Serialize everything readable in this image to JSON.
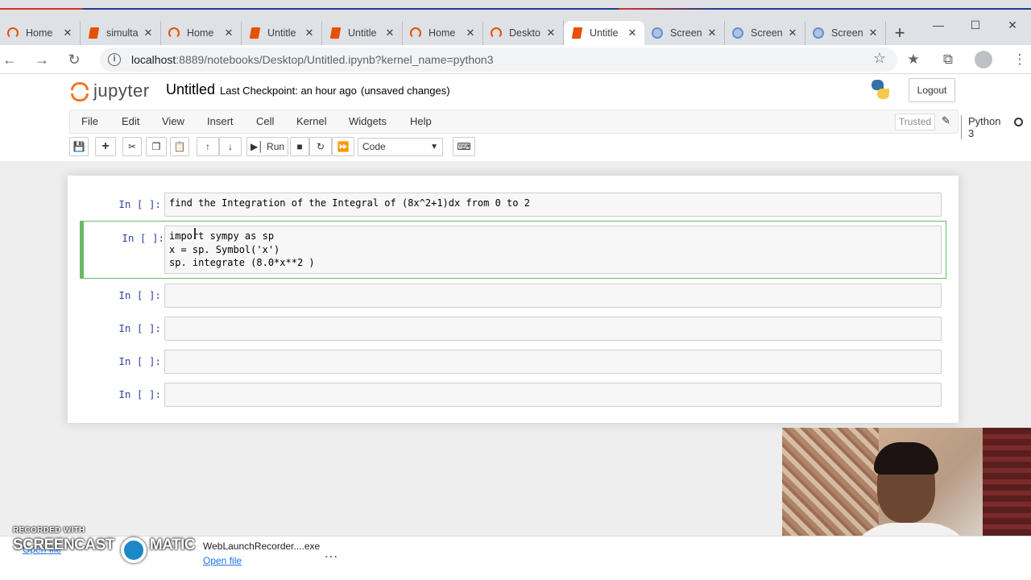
{
  "browser": {
    "tabs": [
      {
        "title": "Home",
        "icon": "jupyter-home-icon",
        "active": false
      },
      {
        "title": "simulta",
        "icon": "notebook-icon",
        "active": false
      },
      {
        "title": "Home",
        "icon": "jupyter-home-icon",
        "active": false
      },
      {
        "title": "Untitle",
        "icon": "notebook-icon",
        "active": false
      },
      {
        "title": "Untitle",
        "icon": "notebook-icon",
        "active": false
      },
      {
        "title": "Home",
        "icon": "jupyter-home-icon",
        "active": false
      },
      {
        "title": "Deskto",
        "icon": "jupyter-home-icon",
        "active": false
      },
      {
        "title": "Untitle",
        "icon": "notebook-icon",
        "active": true
      },
      {
        "title": "Screen",
        "icon": "web-icon",
        "active": false
      },
      {
        "title": "Screen",
        "icon": "web-icon",
        "active": false
      },
      {
        "title": "Screen",
        "icon": "web-icon",
        "active": false
      }
    ],
    "url_host": "localhost",
    "url_rest": ":8889/notebooks/Desktop/Untitled.ipynb?kernel_name=python3"
  },
  "jupyter": {
    "logo_text": "jupyter",
    "notebook_name": "Untitled",
    "checkpoint": "Last Checkpoint: an hour ago",
    "unsaved": "(unsaved changes)",
    "logout_label": "Logout",
    "menu": [
      "File",
      "Edit",
      "View",
      "Insert",
      "Cell",
      "Kernel",
      "Widgets",
      "Help"
    ],
    "trusted_label": "Trusted",
    "kernel_name": "Python 3",
    "run_label": "Run",
    "cell_type": "Code",
    "accent_color": "#66bb6a"
  },
  "cells": [
    {
      "prompt": "In [ ]:",
      "lines": [
        "find the Integration of the Integral of (8x^2+1)dx from 0 to 2"
      ],
      "selected": false
    },
    {
      "prompt": "In [ ]:",
      "lines": [
        "import sympy as sp",
        "x = sp. Symbol('x')",
        "sp. integrate (8.0*x**2 )"
      ],
      "selected": true
    },
    {
      "prompt": "In [ ]:",
      "lines": [
        ""
      ],
      "selected": false
    },
    {
      "prompt": "In [ ]:",
      "lines": [
        ""
      ],
      "selected": false
    },
    {
      "prompt": "In [ ]:",
      "lines": [
        ""
      ],
      "selected": false
    },
    {
      "prompt": "In [ ]:",
      "lines": [
        ""
      ],
      "selected": false
    }
  ],
  "downloads": {
    "item1_name": "",
    "item1_open": "Open file",
    "item2_name": "WebLaunchRecorder....exe",
    "item2_open": "Open file"
  },
  "watermark": {
    "line1": "RECORDED WITH",
    "line2": "SCREENCAST",
    "line3": "MATIC"
  }
}
